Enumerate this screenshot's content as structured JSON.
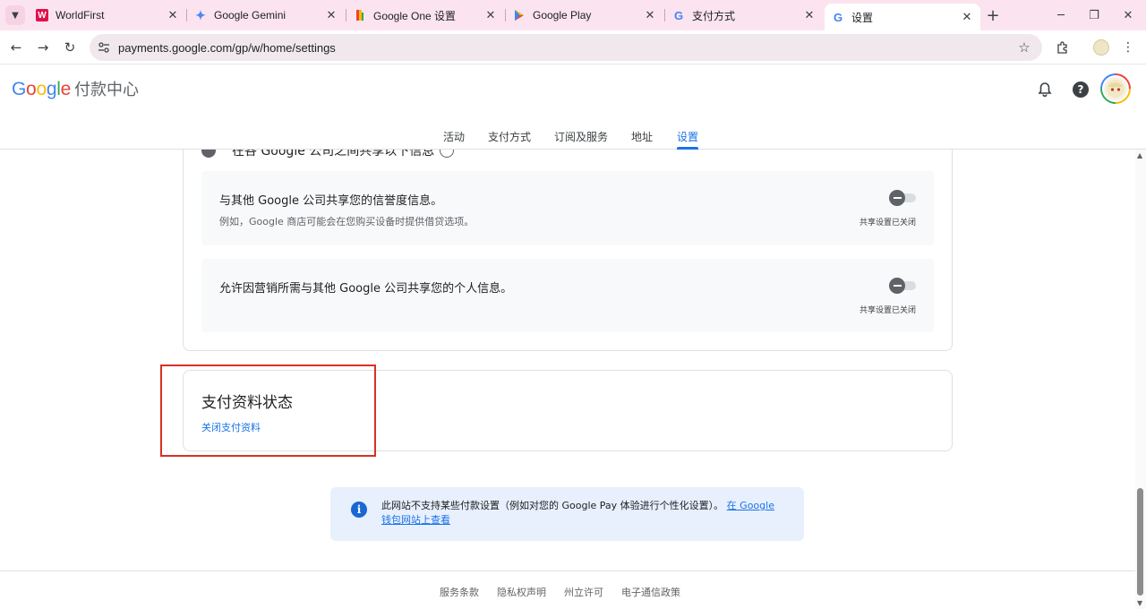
{
  "browser": {
    "tabs": [
      {
        "title": "WorldFirst",
        "favicon": "worldfirst-icon",
        "favicon_color": "#e0124b",
        "favicon_text": "W"
      },
      {
        "title": "Google Gemini",
        "favicon": "gemini-icon",
        "favicon_color": "#4e86f5"
      },
      {
        "title": "Google One 设置",
        "favicon": "google-one-icon",
        "favicon_color": "#ea4335"
      },
      {
        "title": "Google Play",
        "favicon": "google-play-icon",
        "favicon_color": "#34a853"
      },
      {
        "title": "支付方式",
        "favicon": "google-g-icon",
        "favicon_color": "#4285f4"
      },
      {
        "title": "设置",
        "favicon": "google-g-icon",
        "favicon_color": "#4285f4",
        "active": true
      }
    ],
    "url": "payments.google.com/gp/w/home/settings"
  },
  "header": {
    "logo_text": "Google",
    "product_name": "付款中心",
    "nav_tabs": [
      {
        "label": "活动"
      },
      {
        "label": "支付方式"
      },
      {
        "label": "订阅及服务"
      },
      {
        "label": "地址"
      },
      {
        "label": "设置",
        "active": true
      }
    ]
  },
  "sharing": {
    "section_heading": "在各 Google 公司之间共享以下信息",
    "rows": [
      {
        "label": "与其他 Google 公司共享您的信誉度信息。",
        "description": "例如，Google 商店可能会在您购买设备时提供借贷选项。",
        "state": "共享设置已关闭",
        "enabled": false
      },
      {
        "label": "允许因营销所需与其他 Google 公司共享您的个人信息。",
        "description": "",
        "state": "共享设置已关闭",
        "enabled": false
      }
    ]
  },
  "profile_status": {
    "title": "支付资料状态",
    "close_link": "关闭支付资料"
  },
  "notice": {
    "text": "此网站不支持某些付款设置（例如对您的 Google Pay 体验进行个性化设置）。",
    "link": "在 Google 钱包网站上查看"
  },
  "footer": {
    "links": [
      "服务条款",
      "隐私权声明",
      "州立许可",
      "电子通信政策"
    ]
  },
  "colors": {
    "accent": "#1a73e8",
    "highlight": "#d93025",
    "tabstrip": "#fbe4ef"
  }
}
